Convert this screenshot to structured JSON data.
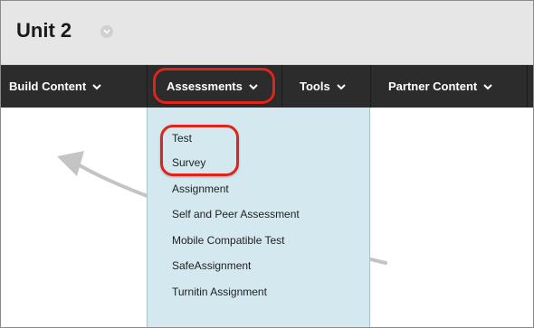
{
  "page": {
    "title": "Unit 2",
    "title_icon": "chevron-down-icon"
  },
  "toolbar": {
    "items": [
      {
        "label": "Build Content",
        "icon": "chevron-down-icon"
      },
      {
        "label": "Assessments",
        "icon": "chevron-down-icon"
      },
      {
        "label": "Tools",
        "icon": "chevron-down-icon"
      },
      {
        "label": "Partner Content",
        "icon": "chevron-down-icon"
      }
    ]
  },
  "assessments_menu": {
    "items": [
      "Test",
      "Survey",
      "Assignment",
      "Self and Peer Assessment",
      "Mobile Compatible Test",
      "SafeAssignment",
      "Turnitin Assignment"
    ]
  },
  "annotation": {
    "highlight_color": "#e0231b",
    "arrow_color": "#bdbdbd"
  }
}
